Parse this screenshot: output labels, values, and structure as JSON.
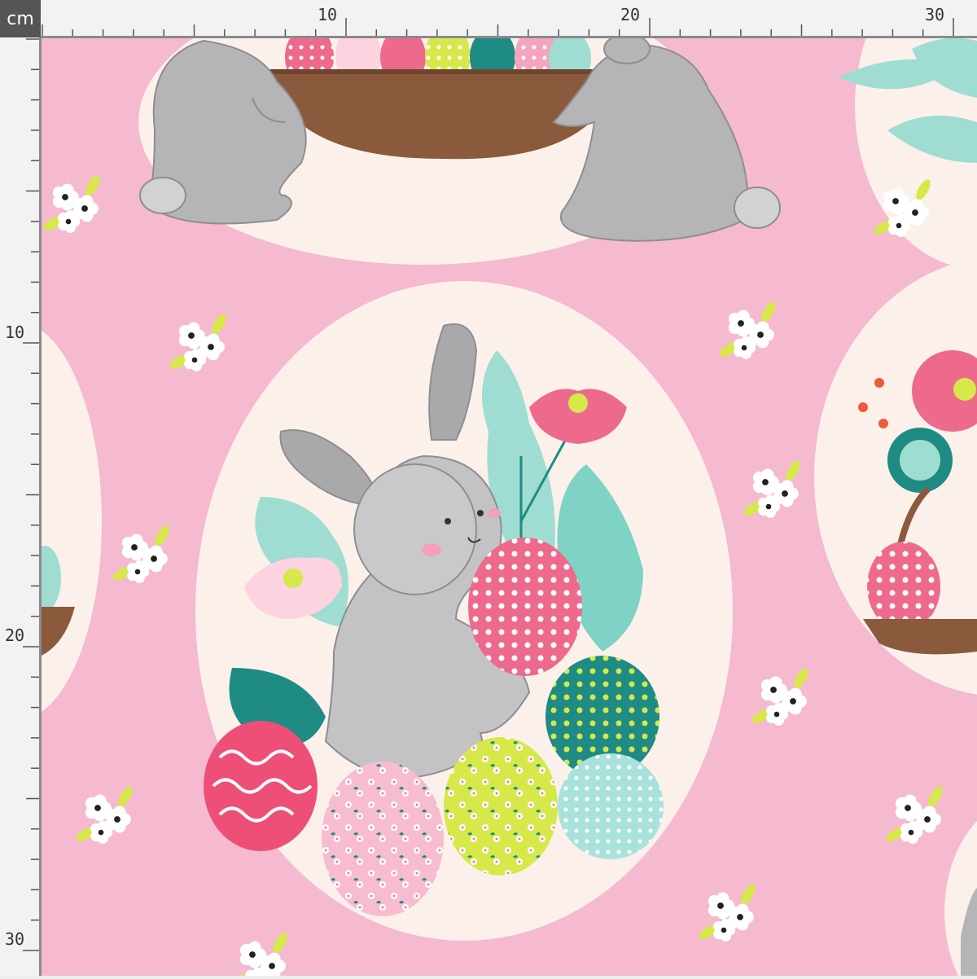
{
  "ruler": {
    "unit": "cm",
    "top_labels": [
      "10",
      "20",
      "30"
    ],
    "left_labels": [
      "10",
      "20",
      "30"
    ]
  },
  "fabric": {
    "background_color": "#f5b9d0",
    "medallion_color": "#fbf1ea",
    "bunny_color": "#b5b5b7",
    "accent_pink": "#ee6a8d",
    "accent_mint": "#9fddd2",
    "accent_teal": "#1e8c84",
    "accent_lime": "#d7e84a",
    "basket_color": "#8b5a3c"
  }
}
